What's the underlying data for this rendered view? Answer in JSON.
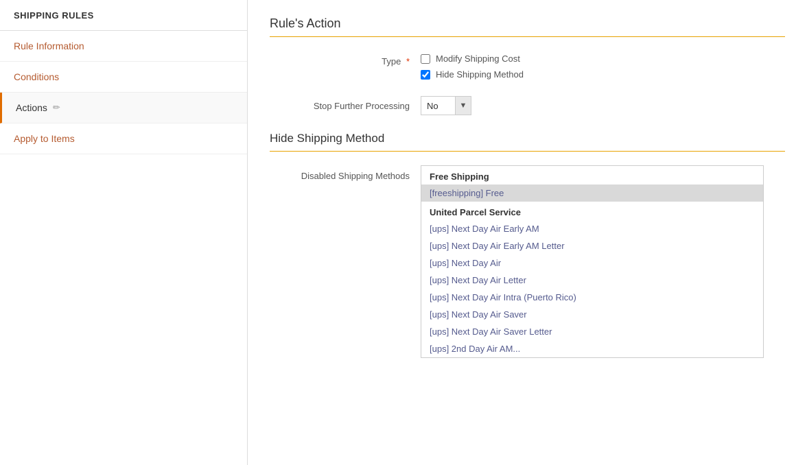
{
  "sidebar": {
    "header": "SHIPPING RULES",
    "items": [
      {
        "id": "rule-information",
        "label": "Rule Information",
        "active": false
      },
      {
        "id": "conditions",
        "label": "Conditions",
        "active": false
      },
      {
        "id": "actions",
        "label": "Actions",
        "active": true
      },
      {
        "id": "apply-to-items",
        "label": "Apply to Items",
        "active": false
      }
    ]
  },
  "main": {
    "section_title": "Rule's Action",
    "type_label": "Type",
    "modify_shipping_label": "Modify Shipping Cost",
    "hide_shipping_label": "Hide Shipping Method",
    "stop_further_label": "Stop Further Processing",
    "stop_value": "No",
    "sub_section_title": "Hide Shipping Method",
    "disabled_methods_label": "Disabled Shipping Methods",
    "shipping_groups": [
      {
        "group_name": "Free Shipping",
        "items": [
          {
            "id": "freeshipping_free",
            "label": "[freeshipping] Free",
            "selected": true
          }
        ]
      },
      {
        "group_name": "United Parcel Service",
        "items": [
          {
            "id": "ups_1da",
            "label": "[ups] Next Day Air Early AM",
            "selected": false
          },
          {
            "id": "ups_1dml",
            "label": "[ups] Next Day Air Early AM Letter",
            "selected": false
          },
          {
            "id": "ups_1dp",
            "label": "[ups] Next Day Air",
            "selected": false
          },
          {
            "id": "ups_1dl",
            "label": "[ups] Next Day Air Letter",
            "selected": false
          },
          {
            "id": "ups_1dapi",
            "label": "[ups] Next Day Air Intra (Puerto Rico)",
            "selected": false
          },
          {
            "id": "ups_1ds",
            "label": "[ups] Next Day Air Saver",
            "selected": false
          },
          {
            "id": "ups_1dsl",
            "label": "[ups] Next Day Air Saver Letter",
            "selected": false
          },
          {
            "id": "ups_2dml",
            "label": "[ups] 2nd Day Air AM...",
            "selected": false
          }
        ]
      }
    ]
  }
}
